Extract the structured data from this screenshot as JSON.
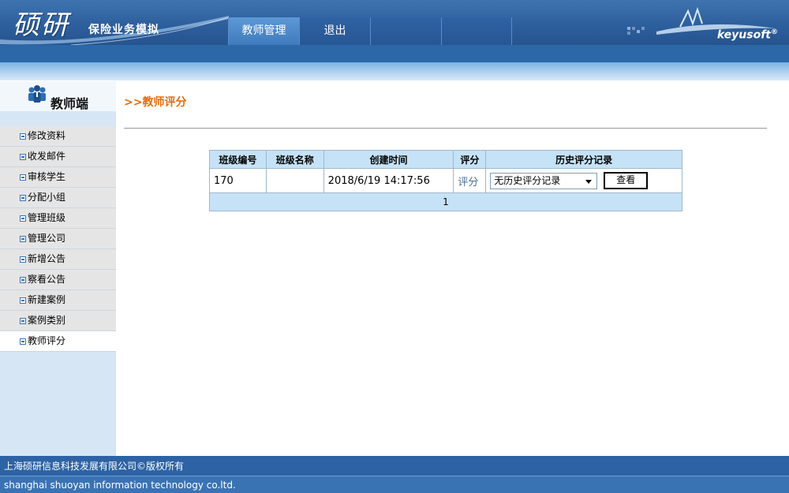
{
  "header": {
    "logo_text": "硕研",
    "logo_subtitle": "保险业务模拟",
    "nav": [
      {
        "label": "教师管理",
        "active": true
      },
      {
        "label": "退出",
        "active": false
      },
      {
        "label": "",
        "active": false
      },
      {
        "label": "",
        "active": false
      }
    ],
    "brand": "keyusoft",
    "brand_mark": "®"
  },
  "sidebar": {
    "title": "教师端",
    "icon": "users-group-icon",
    "items": [
      {
        "label": "修改资料"
      },
      {
        "label": "收发邮件"
      },
      {
        "label": "审核学生"
      },
      {
        "label": "分配小组"
      },
      {
        "label": "管理班级"
      },
      {
        "label": "管理公司"
      },
      {
        "label": "新增公告"
      },
      {
        "label": "察看公告"
      },
      {
        "label": "新建案例"
      },
      {
        "label": "案例类别"
      },
      {
        "label": "教师评分",
        "active": true
      }
    ]
  },
  "main": {
    "breadcrumb": ">>教师评分",
    "table": {
      "headers": [
        "班级编号",
        "班级名称",
        "创建时间",
        "评分",
        "历史评分记录"
      ],
      "rows": [
        {
          "class_id": "170",
          "class_name": "",
          "created": "2018/6/19 14:17:56",
          "rate_link": "评分",
          "history_select": "无历史评分记录",
          "view_button": "查看"
        }
      ],
      "page": "1"
    }
  },
  "footer": {
    "line1": "上海硕研信息科技发展有限公司©版权所有",
    "line2": "shanghai shuoyan information technology co.ltd."
  },
  "colors": {
    "header_blue": "#2d5f9d",
    "table_header": "#c6e2f6",
    "breadcrumb_orange": "#e46c0a",
    "sidebar_bg": "#d6e6f4"
  }
}
